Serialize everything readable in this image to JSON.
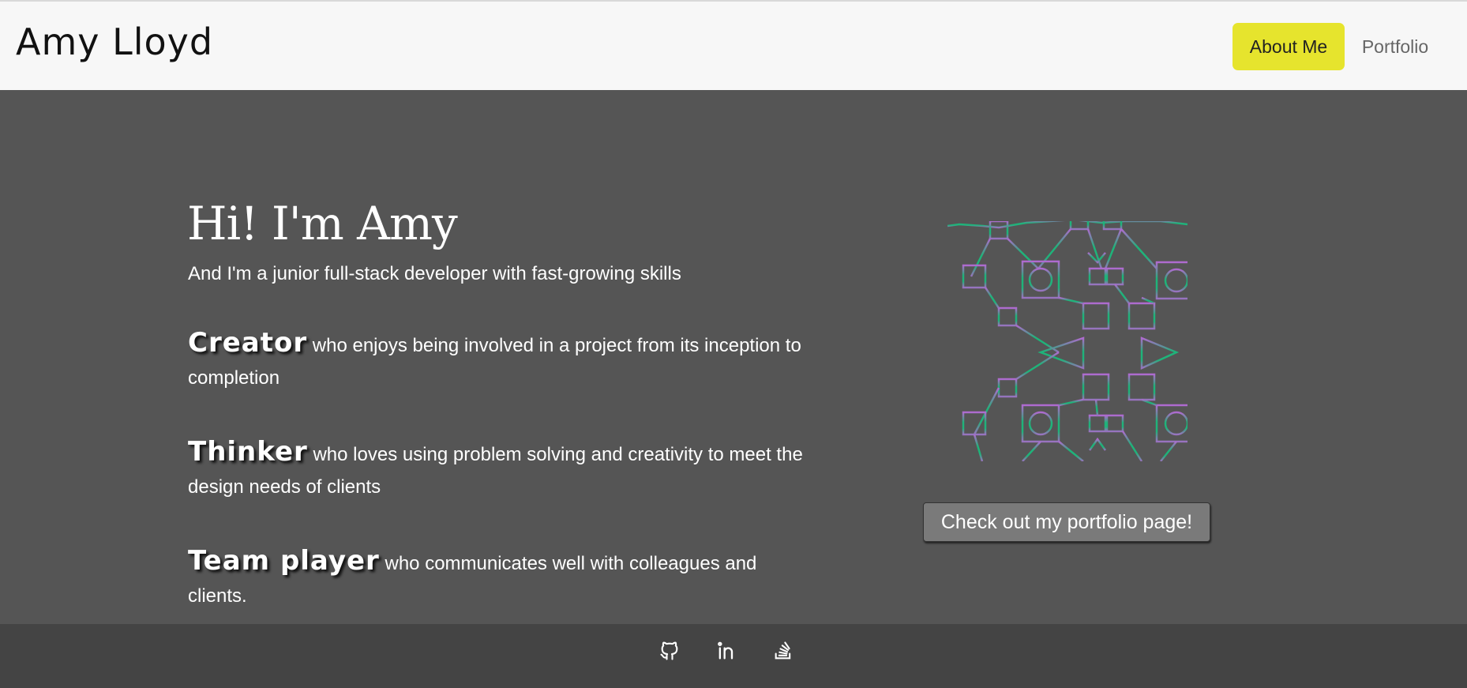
{
  "header": {
    "brand": "Amy Lloyd",
    "nav": [
      {
        "label": "About Me",
        "active": true
      },
      {
        "label": "Portfolio",
        "active": false
      }
    ],
    "active_color": "#e6e42d"
  },
  "hero": {
    "title": "Hi! I'm Amy",
    "subtitle": "And I'm a junior full-stack developer with fast-growing skills",
    "traits": [
      {
        "term": "Creator",
        "text": "who enjoys being involved in a project from its inception to completion"
      },
      {
        "term": "Thinker",
        "text": "who loves using problem solving and creativity to meet the design needs of clients"
      },
      {
        "term": "Team player",
        "text": "who communicates well with colleagues and clients."
      }
    ]
  },
  "graphic": {
    "icon": "geometric-network-pattern",
    "colors": [
      "#b06ad0",
      "#5f8f9a",
      "#1fb37a"
    ]
  },
  "cta": {
    "label": "Check out my portfolio page!"
  },
  "footer": {
    "icons": [
      "github-icon",
      "linkedin-icon",
      "stack-overflow-icon"
    ]
  },
  "colors": {
    "header_bg": "#f7f7f7",
    "main_bg": "#555555",
    "footer_bg": "#444444"
  }
}
